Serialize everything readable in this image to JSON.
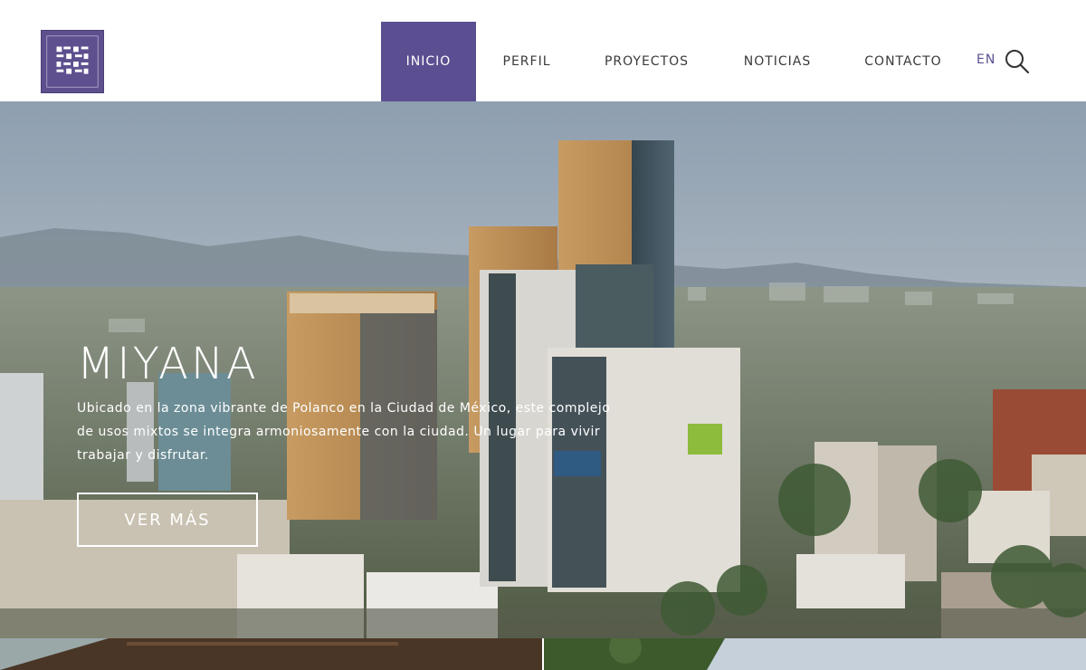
{
  "header": {
    "logo_alt": "LEGORRETA",
    "nav": [
      {
        "label": "INICIO",
        "active": true
      },
      {
        "label": "PERFIL",
        "active": false
      },
      {
        "label": "PROYECTOS",
        "active": false
      },
      {
        "label": "NOTICIAS",
        "active": false
      },
      {
        "label": "CONTACTO",
        "active": false
      }
    ],
    "lang": "EN",
    "search_icon": "search-icon"
  },
  "hero": {
    "title": "MIYANA",
    "description": "Ubicado en la zona vibrante de Polanco en la Ciudad de México, este complejo de usos mixtos se integra armoniosamente con la ciudad. Un lugar para vivir trabajar y disfrutar.",
    "button": "VER MÁS"
  },
  "colors": {
    "accent": "#5c4f91",
    "header_bg": "#ffffff"
  }
}
